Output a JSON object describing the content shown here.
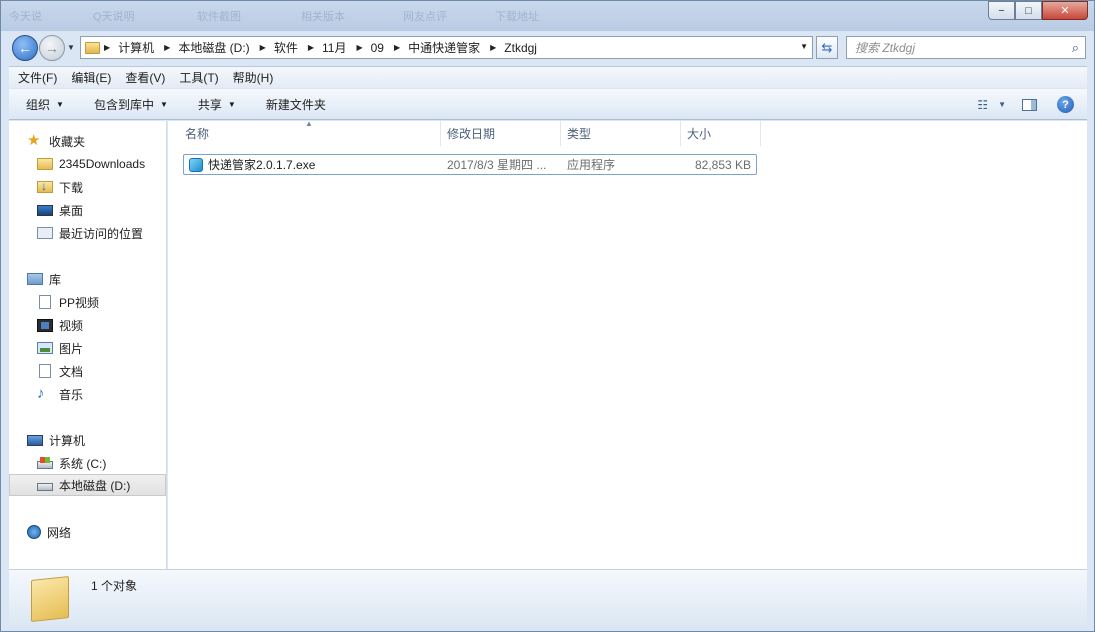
{
  "window": {
    "ghost_tabs": [
      "今天说",
      "Q天说明",
      "软件截图",
      "相关版本",
      "网友点评",
      "下载地址"
    ],
    "controls": {
      "minimize": "−",
      "maximize": "□",
      "close": "✕"
    }
  },
  "nav": {
    "breadcrumbs": [
      "计算机",
      "本地磁盘 (D:)",
      "软件",
      "11月",
      "09",
      "中通快递管家",
      "Ztkdgj"
    ],
    "search_placeholder": "搜索 Ztkdgj"
  },
  "menu": [
    "文件(F)",
    "编辑(E)",
    "查看(V)",
    "工具(T)",
    "帮助(H)"
  ],
  "toolbar": {
    "organize": "组织",
    "include_in_library": "包含到库中",
    "share": "共享",
    "new_folder": "新建文件夹"
  },
  "sidebar": {
    "favorites": {
      "label": "收藏夹",
      "items": [
        "2345Downloads",
        "下载",
        "桌面",
        "最近访问的位置"
      ]
    },
    "libraries": {
      "label": "库",
      "items": [
        "PP视频",
        "视频",
        "图片",
        "文档",
        "音乐"
      ]
    },
    "computer": {
      "label": "计算机",
      "items": [
        "系统 (C:)",
        "本地磁盘 (D:)"
      ]
    },
    "network": {
      "label": "网络"
    }
  },
  "columns": [
    "名称",
    "修改日期",
    "类型",
    "大小"
  ],
  "files": [
    {
      "name": "快递管家2.0.1.7.exe",
      "modified": "2017/8/3 星期四 ...",
      "type": "应用程序",
      "size": "82,853 KB"
    }
  ],
  "details": {
    "count_text": "1 个对象"
  }
}
